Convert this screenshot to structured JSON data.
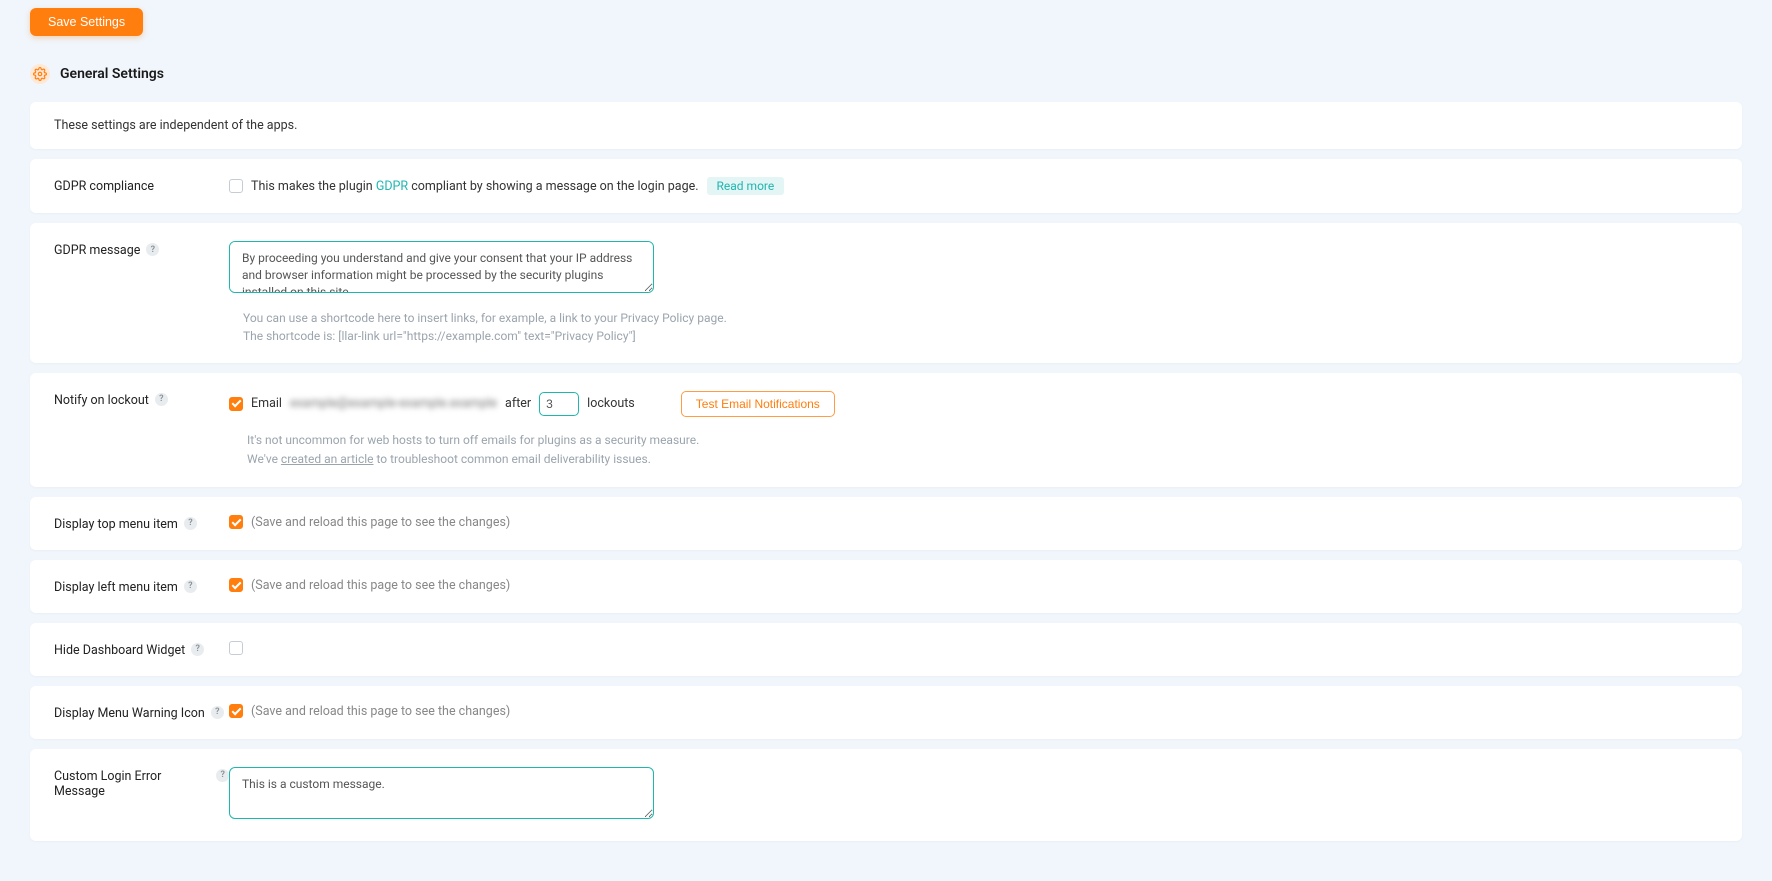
{
  "save_button": "Save Settings",
  "section_title": "General Settings",
  "description": "These settings are independent of the apps.",
  "gdpr_compliance": {
    "label": "GDPR compliance",
    "checked": false,
    "text_before": "This makes the plugin ",
    "text_link": "GDPR",
    "text_after": " compliant by showing a message on the login page.",
    "read_more": "Read more"
  },
  "gdpr_message": {
    "label": "GDPR message",
    "value": "By proceeding you understand and give your consent that your IP address and browser information might be processed by the security plugins installed on this site.",
    "help1": "You can use a shortcode here to insert links, for example, a link to your Privacy Policy page.",
    "help2": "The shortcode is: [llar-link url=\"https://example.com\" text=\"Privacy Policy\"]"
  },
  "notify": {
    "label": "Notify on lockout",
    "checked": true,
    "email_prefix": "Email",
    "email_blurred": "example@example-example.example",
    "after_word": "after",
    "count": "3",
    "lockouts_word": "lockouts",
    "test_button": "Test Email Notifications",
    "info1": "It's not uncommon for web hosts to turn off emails for plugins as a security measure.",
    "info2_before": "We've ",
    "info2_link": "created an article",
    "info2_after": " to troubleshoot common email deliverability issues."
  },
  "display_top": {
    "label": "Display top menu item",
    "checked": true,
    "note": "(Save and reload this page to see the changes)"
  },
  "display_left": {
    "label": "Display left menu item",
    "checked": true,
    "note": "(Save and reload this page to see the changes)"
  },
  "hide_widget": {
    "label": "Hide Dashboard Widget",
    "checked": false
  },
  "display_warning": {
    "label": "Display Menu Warning Icon",
    "checked": true,
    "note": "(Save and reload this page to see the changes)"
  },
  "custom_login": {
    "label": "Custom Login Error Message",
    "value": "This is a custom message."
  }
}
